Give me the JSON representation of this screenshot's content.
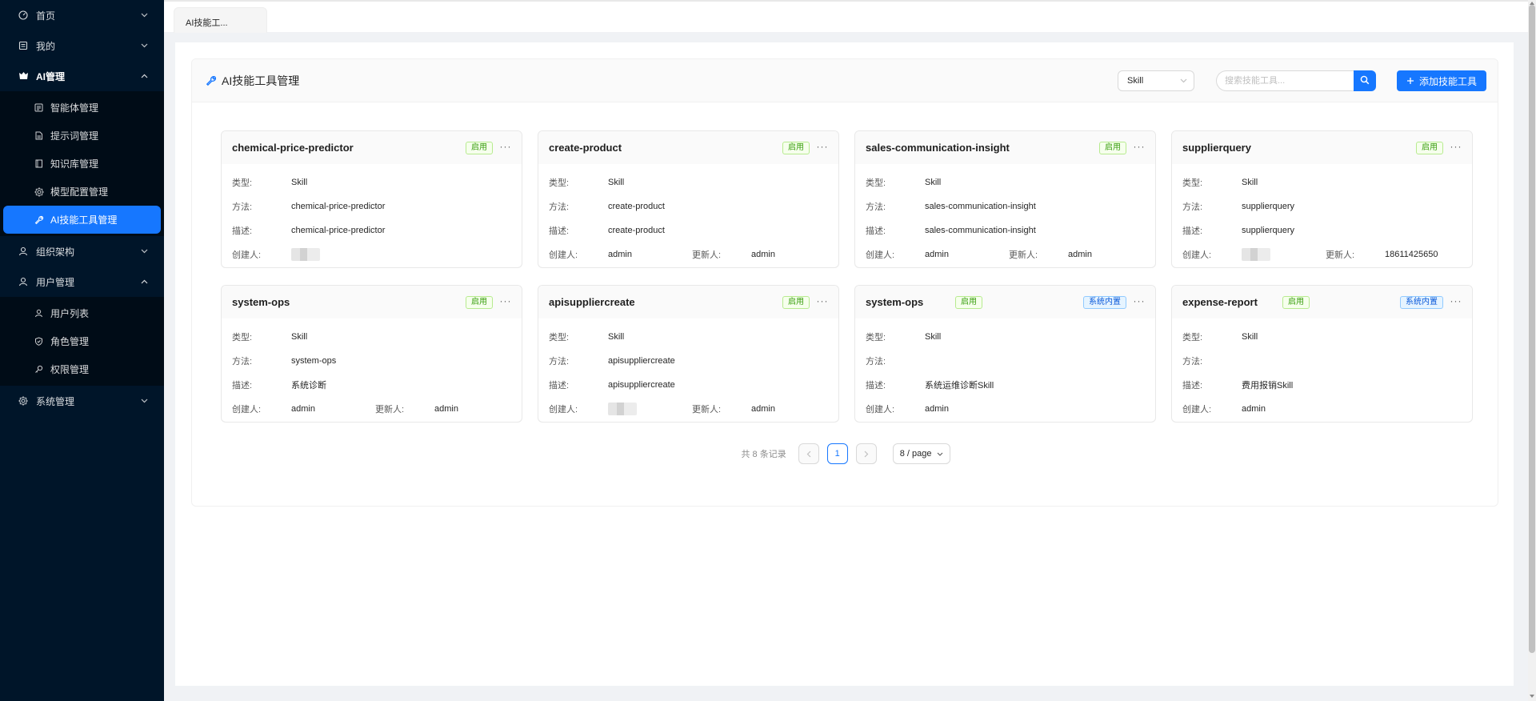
{
  "sidebar": {
    "items": [
      {
        "label": "首页",
        "icon": "dashboard-icon",
        "open": false
      },
      {
        "label": "我的",
        "icon": "mine-icon",
        "open": false
      },
      {
        "label": "AI管理",
        "icon": "ai-icon",
        "open": true,
        "children": [
          {
            "label": "智能体管理",
            "icon": "agent-icon"
          },
          {
            "label": "提示词管理",
            "icon": "prompt-icon"
          },
          {
            "label": "知识库管理",
            "icon": "book-icon"
          },
          {
            "label": "模型配置管理",
            "icon": "gear-icon"
          },
          {
            "label": "AI技能工具管理",
            "icon": "wrench-icon",
            "active": true
          }
        ]
      },
      {
        "label": "组织架构",
        "icon": "org-icon",
        "open": false
      },
      {
        "label": "用户管理",
        "icon": "user-icon",
        "open": true,
        "children": [
          {
            "label": "用户列表",
            "icon": "user-icon"
          },
          {
            "label": "角色管理",
            "icon": "role-icon"
          },
          {
            "label": "权限管理",
            "icon": "key-icon"
          }
        ]
      },
      {
        "label": "系统管理",
        "icon": "gear-icon",
        "open": false
      }
    ]
  },
  "tabs": [
    {
      "label": "AI技能工..."
    }
  ],
  "panel": {
    "title": "AI技能工具管理",
    "type_select": {
      "value": "Skill"
    },
    "search": {
      "placeholder": "搜索技能工具..."
    },
    "add_button": "添加技能工具"
  },
  "labels": {
    "type": "类型:",
    "method": "方法:",
    "desc": "描述:",
    "creator": "创建人:",
    "updater": "更新人:"
  },
  "cards": [
    {
      "title": "chemical-price-predictor",
      "tags": [
        "启用"
      ],
      "type": "Skill",
      "method": "chemical-price-predictor",
      "desc": "chemical-price-predictor",
      "creator": "",
      "creator_blurred": true,
      "updater": ""
    },
    {
      "title": "create-product",
      "tags": [
        "启用"
      ],
      "type": "Skill",
      "method": "create-product",
      "desc": "create-product",
      "creator": "admin",
      "updater": "admin"
    },
    {
      "title": "sales-communication-insight",
      "tags": [
        "启用"
      ],
      "type": "Skill",
      "method": "sales-communication-insight",
      "desc": "sales-communication-insight",
      "creator": "admin",
      "updater": "admin"
    },
    {
      "title": "supplierquery",
      "tags": [
        "启用"
      ],
      "type": "Skill",
      "method": "supplierquery",
      "desc": "supplierquery",
      "creator": "",
      "creator_blurred": true,
      "updater": "18611425650"
    },
    {
      "title": "system-ops",
      "tags": [
        "启用"
      ],
      "type": "Skill",
      "method": "system-ops",
      "desc": "系统诊断",
      "creator": "admin",
      "updater": "admin"
    },
    {
      "title": "apisuppliercreate",
      "tags": [
        "启用"
      ],
      "type": "Skill",
      "method": "apisuppliercreate",
      "desc": "apisuppliercreate",
      "creator": "",
      "creator_blurred": true,
      "updater": "admin"
    },
    {
      "title": "system-ops",
      "tags": [
        "启用",
        "系统内置"
      ],
      "type": "Skill",
      "method": "",
      "desc": "系统运维诊断Skill",
      "creator": "admin",
      "updater": ""
    },
    {
      "title": "expense-report",
      "tags": [
        "启用",
        "系统内置"
      ],
      "type": "Skill",
      "method": "",
      "desc": "费用报销Skill",
      "creator": "admin",
      "updater": ""
    }
  ],
  "pagination": {
    "total": "共 8 条记录",
    "current": "1",
    "page_size": "8 / page"
  },
  "colors": {
    "primary": "#1677ff",
    "sidebar": "#001529",
    "submenu": "#000c17",
    "enabled_tag": "#389e0d",
    "builtin_tag": "#0958d9"
  }
}
